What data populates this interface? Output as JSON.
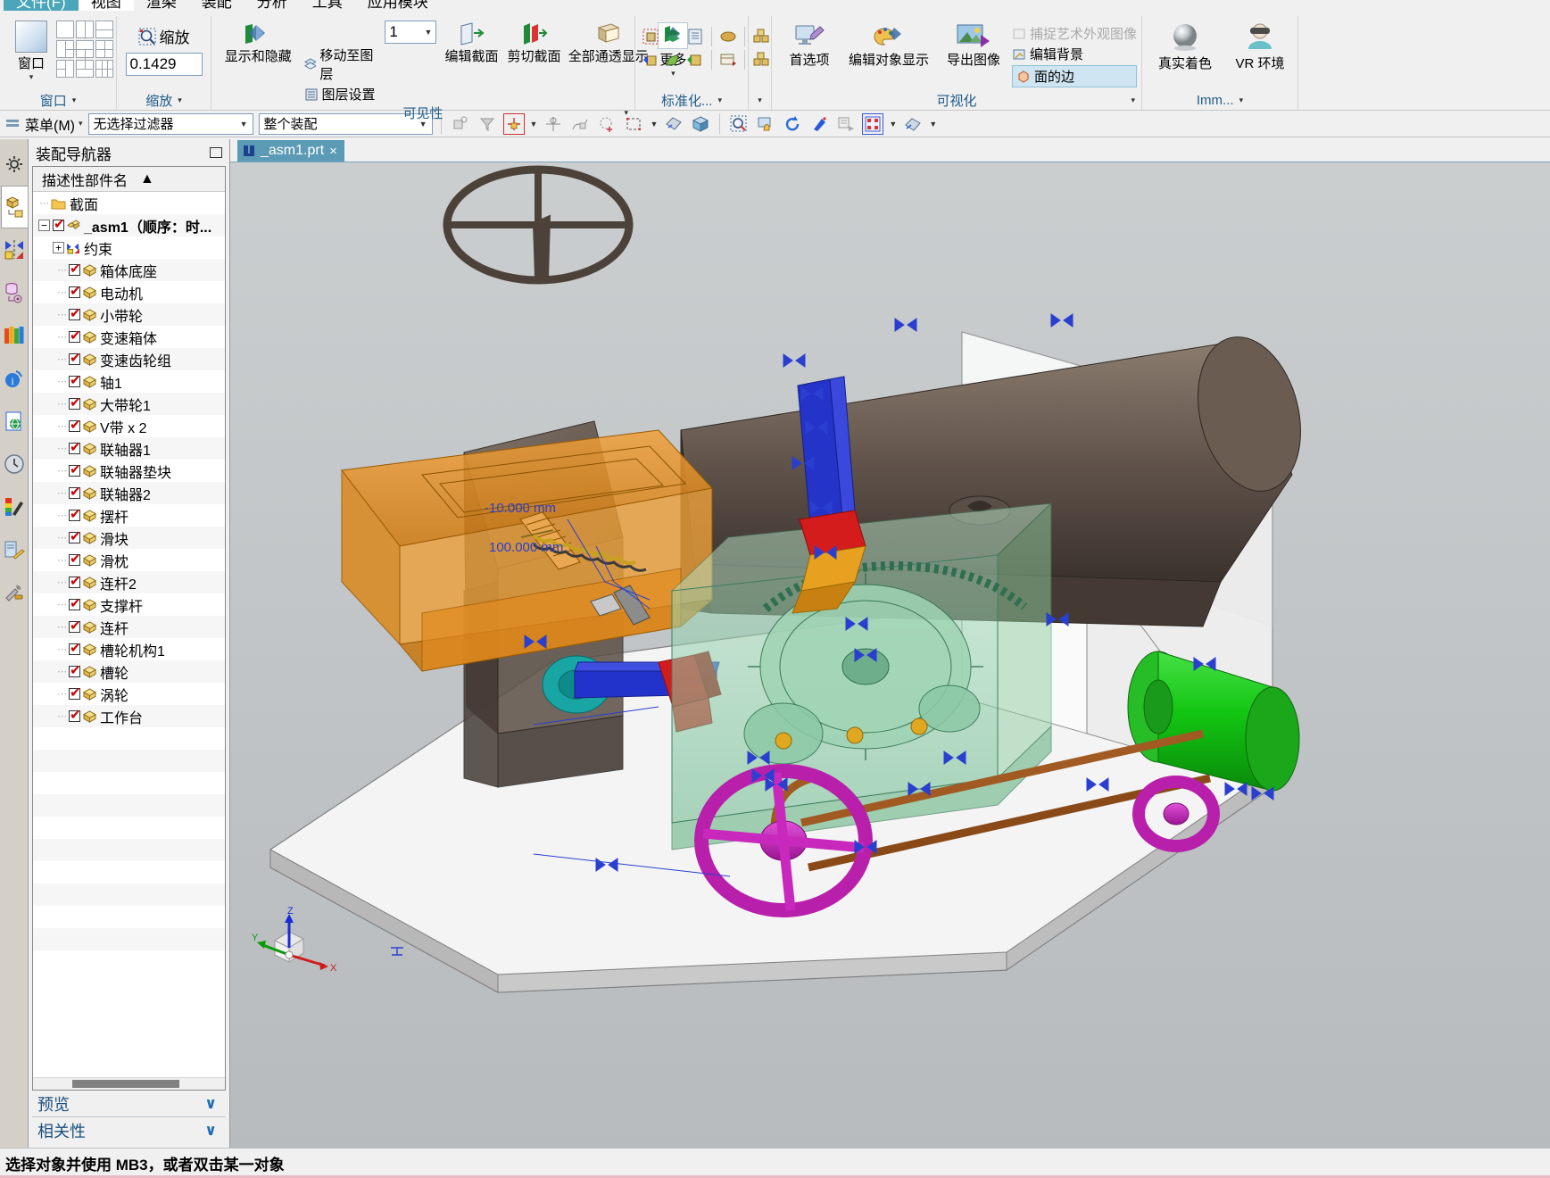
{
  "menu": {
    "items": [
      {
        "label": "文件(F)",
        "state": "teal"
      },
      {
        "label": "视图",
        "state": "active"
      },
      {
        "label": "渲染",
        "state": "normal"
      },
      {
        "label": "装配",
        "state": "normal"
      },
      {
        "label": "分析",
        "state": "normal"
      },
      {
        "label": "工具",
        "state": "normal"
      },
      {
        "label": "应用模块",
        "state": "normal"
      }
    ]
  },
  "ribbon": {
    "groups": [
      {
        "name": "window",
        "title": "窗口",
        "primary_label": "窗口",
        "caret": "▾"
      },
      {
        "name": "zoom",
        "title": "缩放",
        "zoom_label": "缩放",
        "zoom_value": "0.1429"
      },
      {
        "name": "visibility",
        "title": "可见性",
        "show_hide": "显示和隐藏",
        "move_to_layer": "移动至图层",
        "layer_settings": "图层设置",
        "edit_section": "编辑截面",
        "clip_section": "剪切截面",
        "all_transparent": "全部通透显示",
        "more": "更多"
      },
      {
        "name": "standardize",
        "title": "标准化..."
      },
      {
        "name": "visualize",
        "title": "可视化",
        "preferences": "首选项",
        "edit_object_display": "编辑对象显示",
        "export_image": "导出图像",
        "capture_art_image": "捕捉艺术外观图像",
        "edit_background": "编辑背景",
        "face_edges": "面的边"
      },
      {
        "name": "immersive",
        "title": "Imm...",
        "true_shading": "真实着色",
        "vr_environment": "VR 环境"
      }
    ]
  },
  "selection_bar": {
    "menu_button": "菜单(M)",
    "menu_caret": "▾",
    "filter_value": "无选择过滤器",
    "scope_value": "整个装配"
  },
  "navigator": {
    "title": "装配导航器",
    "column_header": "描述性部件名",
    "sort_caret": "▲",
    "rows": [
      {
        "label": "截面",
        "level": 1,
        "kind": "folder"
      },
      {
        "label": "_asm1（顺序：时...",
        "level": 0,
        "kind": "asm",
        "bold": true,
        "checked": true,
        "expander": "−"
      },
      {
        "label": "约束",
        "level": 1,
        "kind": "constraint",
        "expander": "+"
      },
      {
        "label": "箱体底座",
        "level": 2,
        "kind": "part",
        "checked": true
      },
      {
        "label": "电动机",
        "level": 2,
        "kind": "part",
        "checked": true
      },
      {
        "label": "小带轮",
        "level": 2,
        "kind": "part",
        "checked": true
      },
      {
        "label": "变速箱体",
        "level": 2,
        "kind": "part",
        "checked": true
      },
      {
        "label": "变速齿轮组",
        "level": 2,
        "kind": "part",
        "checked": true
      },
      {
        "label": "轴1",
        "level": 2,
        "kind": "part",
        "checked": true
      },
      {
        "label": "大带轮1",
        "level": 2,
        "kind": "part",
        "checked": true
      },
      {
        "label": "V带 x 2",
        "level": 2,
        "kind": "part",
        "checked": true
      },
      {
        "label": "联轴器1",
        "level": 2,
        "kind": "part",
        "checked": true
      },
      {
        "label": "联轴器垫块",
        "level": 2,
        "kind": "part",
        "checked": true
      },
      {
        "label": "联轴器2",
        "level": 2,
        "kind": "part",
        "checked": true
      },
      {
        "label": "摆杆",
        "level": 2,
        "kind": "part",
        "checked": true
      },
      {
        "label": "滑块",
        "level": 2,
        "kind": "part",
        "checked": true
      },
      {
        "label": "滑枕",
        "level": 2,
        "kind": "part",
        "checked": true
      },
      {
        "label": "连杆2",
        "level": 2,
        "kind": "part",
        "checked": true
      },
      {
        "label": "支撑杆",
        "level": 2,
        "kind": "part",
        "checked": true
      },
      {
        "label": "连杆",
        "level": 2,
        "kind": "part",
        "checked": true
      },
      {
        "label": "槽轮机构1",
        "level": 2,
        "kind": "part",
        "checked": true
      },
      {
        "label": "槽轮",
        "level": 2,
        "kind": "part",
        "checked": true
      },
      {
        "label": "涡轮",
        "level": 2,
        "kind": "part",
        "checked": true
      },
      {
        "label": "工作台",
        "level": 2,
        "kind": "part",
        "checked": true
      }
    ],
    "footer": [
      {
        "label": "预览",
        "chevron": "∨"
      },
      {
        "label": "相关性",
        "chevron": "∨"
      }
    ]
  },
  "document": {
    "tab_label": "_asm1.prt",
    "tab_close": "×"
  },
  "viewport": {
    "dimension_labels": [
      "-10.000 mm",
      "100.000 mm"
    ],
    "triad": {
      "x": "X",
      "y": "Y",
      "z": "Z"
    },
    "colors": {
      "background_top": "#c9cdd0",
      "background_bottom": "#b9bdc0",
      "base_plate": "#f2f2f2",
      "orange_table": "#e08a1e",
      "green_gearbox": "#7ec49a",
      "green_motor": "#1fcc1f",
      "magenta_pulley": "#c422b8",
      "dark_housing": "#5b4f48",
      "blue_shaft": "#2a3fd0",
      "teal_wheel": "#17a0a0",
      "red_coupler": "#dd1c1c",
      "copper_belt": "#a35d2a"
    }
  },
  "status_bar": {
    "message": "选择对象并使用 MB3，或者双击某一对象"
  }
}
